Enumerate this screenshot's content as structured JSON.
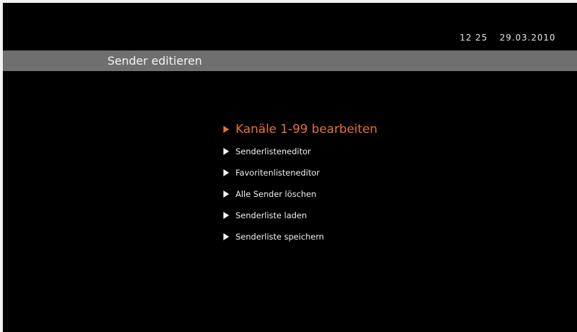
{
  "header": {
    "time": "12 25",
    "date": "29.03.2010",
    "title": "Sender editieren"
  },
  "menu": {
    "items": [
      {
        "label": "Kanäle 1-99 bearbeiten",
        "selected": true
      },
      {
        "label": "Senderlisteneditor",
        "selected": false
      },
      {
        "label": "Favoritenlisteneditor",
        "selected": false
      },
      {
        "label": "Alle Sender löschen",
        "selected": false
      },
      {
        "label": "Senderliste laden",
        "selected": false
      },
      {
        "label": "Senderliste speichern",
        "selected": false
      }
    ]
  },
  "colors": {
    "background": "#000000",
    "title_bar": "#6f6f6f",
    "text": "#f0f0f0",
    "highlight": "#e8732c"
  },
  "icons": {
    "menu_marker": "triangle-right-icon"
  }
}
